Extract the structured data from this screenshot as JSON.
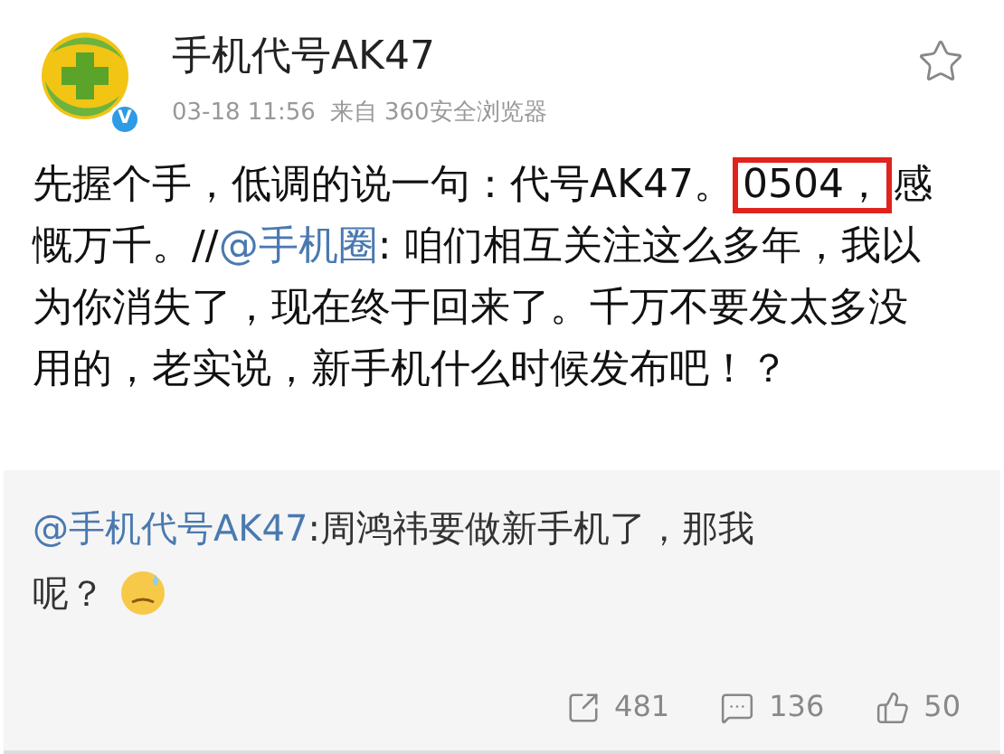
{
  "author": {
    "name": "手机代号AK47",
    "verified_badge": "V"
  },
  "post": {
    "time": "03-18 11:56",
    "source": "来自 360安全浏览器",
    "segments": [
      {
        "kind": "text",
        "text": "先握个手，低调的说一句：代号AK47。"
      },
      {
        "kind": "highlight",
        "text": "0504，"
      },
      {
        "kind": "text",
        "text": "感慨万千。//"
      },
      {
        "kind": "mention",
        "text": "@手机圈"
      },
      {
        "kind": "text",
        "text": ": 咱们相互关注这么多年，我以为你消失了，现在终于回来了。千万不要发太多没用的，老实说，新手机什么时候发布吧！？"
      }
    ]
  },
  "repost": {
    "segments": [
      {
        "kind": "mention",
        "text": "@手机代号AK47"
      },
      {
        "kind": "text",
        "text": ":周鸿祎要做新手机了，那我呢？"
      }
    ],
    "emoji": true
  },
  "stats": [
    {
      "kind": "repost",
      "count": "481"
    },
    {
      "kind": "comment",
      "count": "136"
    },
    {
      "kind": "like",
      "count": "50"
    }
  ]
}
